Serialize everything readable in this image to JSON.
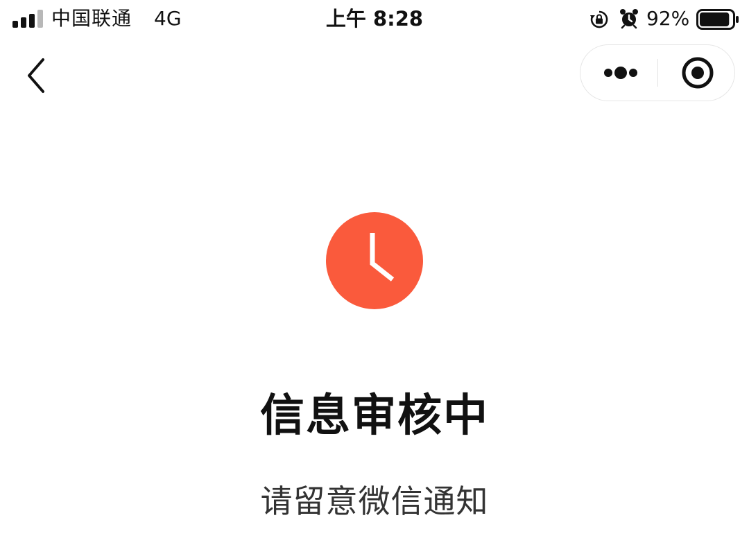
{
  "status_bar": {
    "carrier": "中国联通",
    "network": "4G",
    "time": "上午 8:28",
    "battery_percent": "92%",
    "battery_level": 0.92,
    "signal_bars_active": 3,
    "signal_bars_total": 4,
    "icons": [
      "signal-icon",
      "rotation-lock-icon",
      "alarm-icon",
      "battery-icon"
    ]
  },
  "nav": {
    "back_icon": "chevron-left-icon",
    "capsule_icons": [
      "more-dots-icon",
      "close-target-icon"
    ]
  },
  "main": {
    "status_icon": "clock-icon",
    "title": "信息审核中",
    "subtitle": "请留意微信通知"
  },
  "colors": {
    "accent": "#fa5a3c",
    "text_primary": "#111111",
    "text_secondary": "#333333",
    "capsule_border": "#e6e6e6"
  }
}
